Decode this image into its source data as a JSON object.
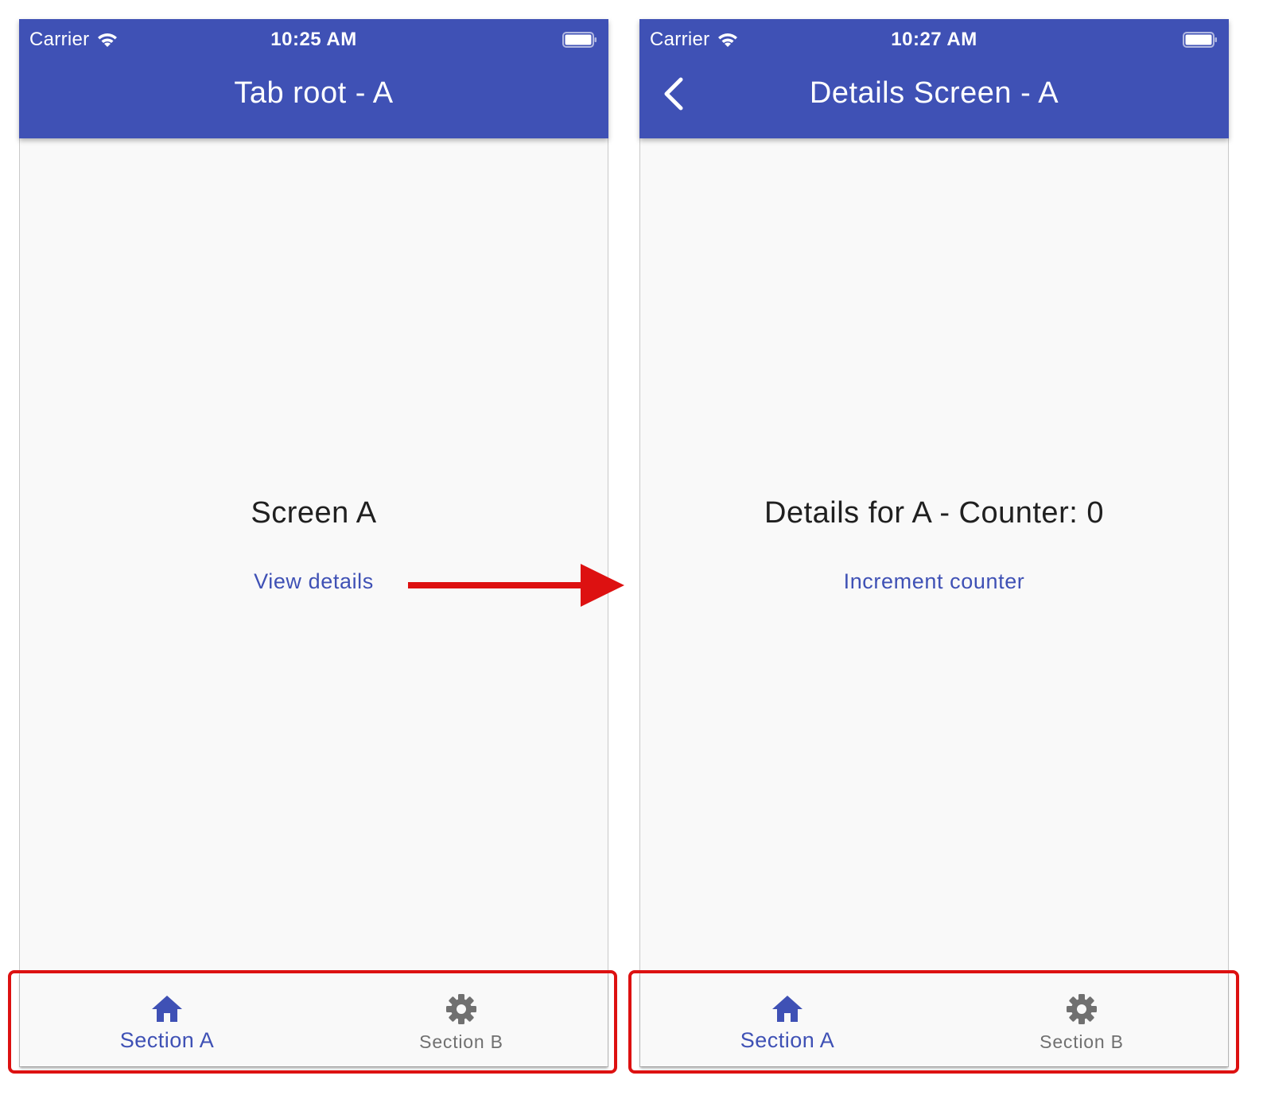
{
  "screens": {
    "left": {
      "status": {
        "carrier": "Carrier",
        "time": "10:25 AM"
      },
      "title": "Tab root - A",
      "main_text": "Screen A",
      "action_label": "View details",
      "nav": {
        "tab_a_label": "Section A",
        "tab_b_label": "Section B",
        "active_tab": "Section A"
      }
    },
    "right": {
      "status": {
        "carrier": "Carrier",
        "time": "10:27 AM"
      },
      "title": "Details Screen - A",
      "main_text": "Details for A - Counter: 0",
      "action_label": "Increment counter",
      "nav": {
        "tab_a_label": "Section A",
        "tab_b_label": "Section B",
        "active_tab": "Section A"
      }
    }
  },
  "icons": {
    "status": [
      "wifi-icon",
      "battery-icon"
    ],
    "appbar": [
      "back-icon"
    ],
    "nav": [
      "home-icon",
      "gear-icon"
    ]
  },
  "colors": {
    "primary": "#3f51b5",
    "background": "#f9f9f9",
    "annotation": "#dd1111",
    "inactive_tab": "#707070"
  }
}
